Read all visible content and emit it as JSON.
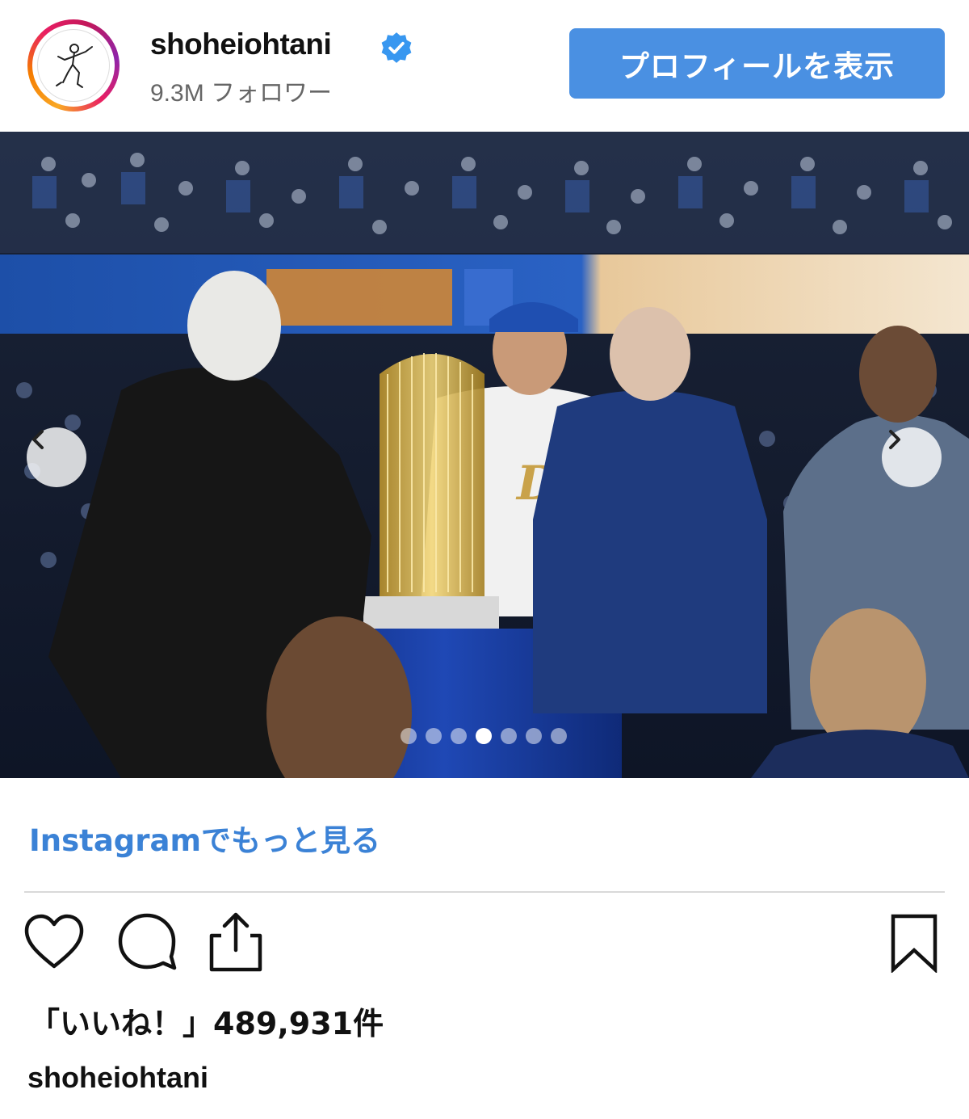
{
  "header": {
    "username": "shoheiohtani",
    "followers": "9.3M フォロワー",
    "profile_button": "プロフィールを表示"
  },
  "post": {
    "image_description_icon": "photo",
    "carousel": {
      "total": 7,
      "active_index": 4
    }
  },
  "more_link": "Instagramでもっと見る",
  "actions": {
    "like_icon": "heart-outline-icon",
    "comment_icon": "speech-bubble-icon",
    "share_icon": "share-upload-icon",
    "save_icon": "bookmark-icon"
  },
  "likes_text": "「いいね！」489,931件",
  "caption_username": "shoheiohtani",
  "colors": {
    "button_blue": "#4a90e2",
    "link_blue": "#3b82d6",
    "verified_blue": "#3897f0"
  }
}
